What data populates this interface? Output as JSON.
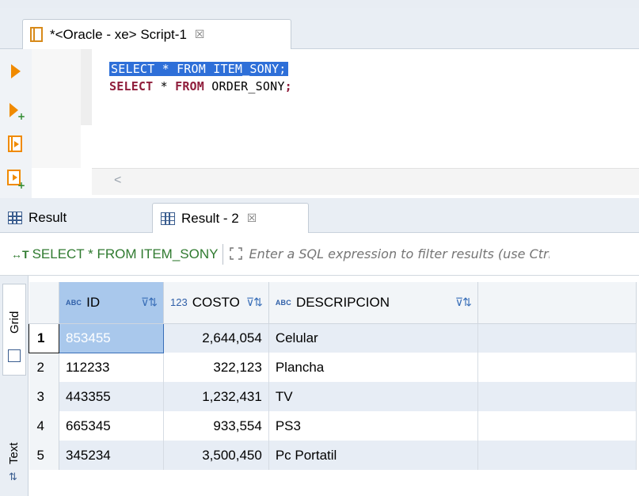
{
  "editor": {
    "tab_title": "*<Oracle - xe> Script-1",
    "tab_close": "☒",
    "code": {
      "line1": "SELECT * FROM ITEM_SONY;",
      "line2_kw1": "SELECT",
      "line2_star": " * ",
      "line2_kw2": "FROM",
      "line2_rest": " ORDER_SONY",
      "line2_semi": ";"
    },
    "scroll_left": "<"
  },
  "toolbar": {
    "icons": [
      "execute-statement-icon",
      "execute-new-tab-icon",
      "execute-script-icon",
      "execute-script-new-tab-icon"
    ]
  },
  "results": {
    "tabs": [
      {
        "label": "Result"
      },
      {
        "label": "Result - 2",
        "close": "☒"
      }
    ],
    "query_label": "SELECT * FROM ITEM_SONY",
    "filter_placeholder": "Enter a SQL expression to filter results (use Ctrl+Space)",
    "side_tabs": [
      "Grid",
      "Text"
    ]
  },
  "grid": {
    "columns": [
      {
        "type": "ABC",
        "name": "ID"
      },
      {
        "type": "123",
        "name": "COSTO"
      },
      {
        "type": "ABC",
        "name": "DESCRIPCION"
      }
    ],
    "rows": [
      {
        "num": "1",
        "id": "853455",
        "costo": "2,644,054",
        "desc": "Celular"
      },
      {
        "num": "2",
        "id": "112233",
        "costo": "322,123",
        "desc": "Plancha"
      },
      {
        "num": "3",
        "id": "443355",
        "costo": "1,232,431",
        "desc": "TV"
      },
      {
        "num": "4",
        "id": "665345",
        "costo": "933,554",
        "desc": "PS3"
      },
      {
        "num": "5",
        "id": "345234",
        "costo": "3,500,450",
        "desc": "Pc Portatil"
      }
    ]
  },
  "colors": {
    "selection": "#2e6fd8",
    "keyword": "#8f1d3b",
    "query_green": "#2f7a2f",
    "row_alt": "#e7edf5",
    "selected_cell": "#a9c8ec"
  }
}
